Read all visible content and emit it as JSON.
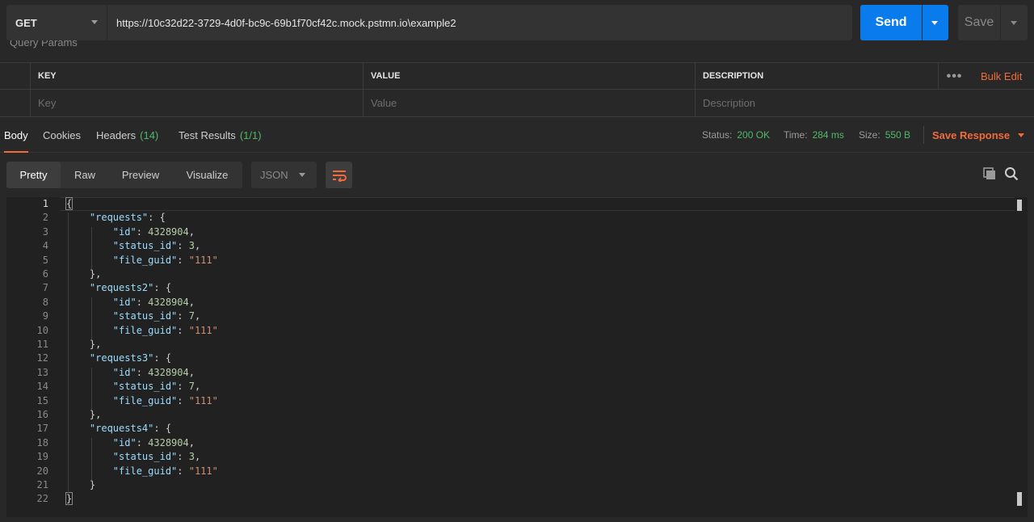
{
  "request": {
    "method": "GET",
    "url": "https://10c32d22-3729-4d0f-bc9c-69b1f70cf42c.mock.pstmn.io\\example2",
    "send_label": "Send",
    "save_label": "Save"
  },
  "query_params": {
    "label": "Query Params",
    "headers": {
      "key": "KEY",
      "value": "VALUE",
      "description": "DESCRIPTION"
    },
    "more_label": "•••",
    "bulk_edit_label": "Bulk Edit",
    "placeholders": {
      "key": "Key",
      "value": "Value",
      "description": "Description"
    }
  },
  "response_tabs": [
    {
      "label": "Body",
      "count": ""
    },
    {
      "label": "Cookies",
      "count": ""
    },
    {
      "label": "Headers",
      "count": "(14)"
    },
    {
      "label": "Test Results",
      "count": "(1/1)"
    }
  ],
  "response_meta": {
    "status_label": "Status:",
    "status_value": "200 OK",
    "time_label": "Time:",
    "time_value": "284 ms",
    "size_label": "Size:",
    "size_value": "550 B",
    "save_response_label": "Save Response"
  },
  "format_buttons": [
    "Pretty",
    "Raw",
    "Preview",
    "Visualize"
  ],
  "format_select": "JSON",
  "icons": {
    "wrap": "wrap-lines-icon",
    "copy": "copy-icon",
    "search": "search-icon"
  },
  "colors": {
    "accent": "#f26b3a",
    "send": "#097bed",
    "success": "#4fb96b",
    "json_key": "#9cdcfe",
    "json_number": "#b5cea8",
    "json_string": "#ce9178"
  },
  "code_lines": [
    [
      {
        "t": "p",
        "v": "{"
      }
    ],
    [
      {
        "t": "p",
        "v": "    "
      },
      {
        "t": "key",
        "v": "\"requests\""
      },
      {
        "t": "p",
        "v": ": {"
      }
    ],
    [
      {
        "t": "p",
        "v": "        "
      },
      {
        "t": "key",
        "v": "\"id\""
      },
      {
        "t": "p",
        "v": ": "
      },
      {
        "t": "num",
        "v": "4328904"
      },
      {
        "t": "p",
        "v": ","
      }
    ],
    [
      {
        "t": "p",
        "v": "        "
      },
      {
        "t": "key",
        "v": "\"status_id\""
      },
      {
        "t": "p",
        "v": ": "
      },
      {
        "t": "num",
        "v": "3"
      },
      {
        "t": "p",
        "v": ","
      }
    ],
    [
      {
        "t": "p",
        "v": "        "
      },
      {
        "t": "key",
        "v": "\"file_guid\""
      },
      {
        "t": "p",
        "v": ": "
      },
      {
        "t": "str",
        "v": "\"111\""
      }
    ],
    [
      {
        "t": "p",
        "v": "    },"
      }
    ],
    [
      {
        "t": "p",
        "v": "    "
      },
      {
        "t": "key",
        "v": "\"requests2\""
      },
      {
        "t": "p",
        "v": ": {"
      }
    ],
    [
      {
        "t": "p",
        "v": "        "
      },
      {
        "t": "key",
        "v": "\"id\""
      },
      {
        "t": "p",
        "v": ": "
      },
      {
        "t": "num",
        "v": "4328904"
      },
      {
        "t": "p",
        "v": ","
      }
    ],
    [
      {
        "t": "p",
        "v": "        "
      },
      {
        "t": "key",
        "v": "\"status_id\""
      },
      {
        "t": "p",
        "v": ": "
      },
      {
        "t": "num",
        "v": "7"
      },
      {
        "t": "p",
        "v": ","
      }
    ],
    [
      {
        "t": "p",
        "v": "        "
      },
      {
        "t": "key",
        "v": "\"file_guid\""
      },
      {
        "t": "p",
        "v": ": "
      },
      {
        "t": "str",
        "v": "\"111\""
      }
    ],
    [
      {
        "t": "p",
        "v": "    },"
      }
    ],
    [
      {
        "t": "p",
        "v": "    "
      },
      {
        "t": "key",
        "v": "\"requests3\""
      },
      {
        "t": "p",
        "v": ": {"
      }
    ],
    [
      {
        "t": "p",
        "v": "        "
      },
      {
        "t": "key",
        "v": "\"id\""
      },
      {
        "t": "p",
        "v": ": "
      },
      {
        "t": "num",
        "v": "4328904"
      },
      {
        "t": "p",
        "v": ","
      }
    ],
    [
      {
        "t": "p",
        "v": "        "
      },
      {
        "t": "key",
        "v": "\"status_id\""
      },
      {
        "t": "p",
        "v": ": "
      },
      {
        "t": "num",
        "v": "7"
      },
      {
        "t": "p",
        "v": ","
      }
    ],
    [
      {
        "t": "p",
        "v": "        "
      },
      {
        "t": "key",
        "v": "\"file_guid\""
      },
      {
        "t": "p",
        "v": ": "
      },
      {
        "t": "str",
        "v": "\"111\""
      }
    ],
    [
      {
        "t": "p",
        "v": "    },"
      }
    ],
    [
      {
        "t": "p",
        "v": "    "
      },
      {
        "t": "key",
        "v": "\"requests4\""
      },
      {
        "t": "p",
        "v": ": {"
      }
    ],
    [
      {
        "t": "p",
        "v": "        "
      },
      {
        "t": "key",
        "v": "\"id\""
      },
      {
        "t": "p",
        "v": ": "
      },
      {
        "t": "num",
        "v": "4328904"
      },
      {
        "t": "p",
        "v": ","
      }
    ],
    [
      {
        "t": "p",
        "v": "        "
      },
      {
        "t": "key",
        "v": "\"status_id\""
      },
      {
        "t": "p",
        "v": ": "
      },
      {
        "t": "num",
        "v": "3"
      },
      {
        "t": "p",
        "v": ","
      }
    ],
    [
      {
        "t": "p",
        "v": "        "
      },
      {
        "t": "key",
        "v": "\"file_guid\""
      },
      {
        "t": "p",
        "v": ": "
      },
      {
        "t": "str",
        "v": "\"111\""
      }
    ],
    [
      {
        "t": "p",
        "v": "    }"
      }
    ],
    [
      {
        "t": "p",
        "v": "}"
      }
    ]
  ]
}
